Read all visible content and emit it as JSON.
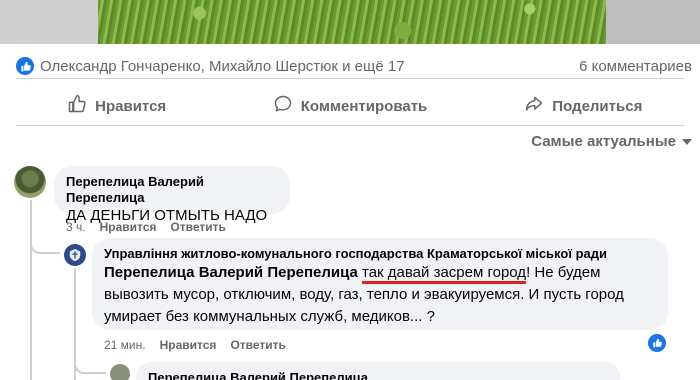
{
  "post": {
    "reactors_text": "Олександр Гончаренко, Михайло Шерстюк и ещё 17",
    "comments_count": "6 комментариев"
  },
  "actions": {
    "like": "Нравится",
    "comment": "Комментировать",
    "share": "Поделиться"
  },
  "sort": {
    "label": "Самые актуальные"
  },
  "comments": [
    {
      "author": "Перепелица Валерий Перепелица",
      "text": "ДА ДЕНЬГИ ОТМЫТЬ НАДО",
      "time": "3 ч.",
      "like": "Нравится",
      "reply": "Ответить"
    },
    {
      "author": "Управління житлово-комунального господарства Краматорської міської ради",
      "tag": "Перепелица Валерий Перепелица",
      "highlighted": "так давай засрем город",
      "rest": "! Не будем вывозить мусор, отключим, воду, газ, тепло и эвакуируемся. И пусть город умирает без коммунальных служб, медиков... ?",
      "time": "21 мин.",
      "like": "Нравится",
      "reply": "Ответить"
    },
    {
      "author": "Перепелица Валерий Перепелица"
    }
  ],
  "colors": {
    "accent": "#1b74e4",
    "highlight_underline": "#e0201b",
    "muted": "#65676b",
    "bubble": "#f0f2f5"
  },
  "icons": {
    "like": "thumbs-up-icon",
    "comment": "speech-bubble-icon",
    "share": "share-arrow-icon",
    "sort": "chevron-down-icon"
  }
}
